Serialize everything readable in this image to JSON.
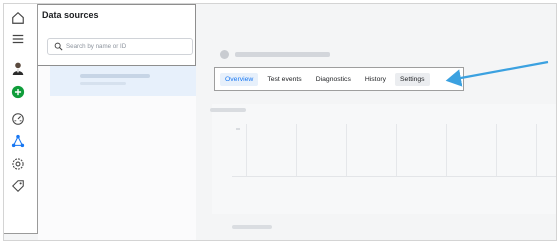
{
  "sidebar": {
    "title": "Data sources",
    "search": {
      "placeholder": "Search by name or ID",
      "value": ""
    }
  },
  "rail": {
    "icons": [
      "home-icon",
      "menu-icon",
      "avatar",
      "add-icon",
      "dashboard-icon",
      "events-manager-icon",
      "settings-icon",
      "tag-icon"
    ]
  },
  "main": {
    "tabs": [
      {
        "label": "Overview"
      },
      {
        "label": "Test events"
      },
      {
        "label": "Diagnostics"
      },
      {
        "label": "History"
      },
      {
        "label": "Settings"
      }
    ]
  },
  "colors": {
    "accent": "#1877f2",
    "annotation_arrow": "#3ba1e0"
  }
}
